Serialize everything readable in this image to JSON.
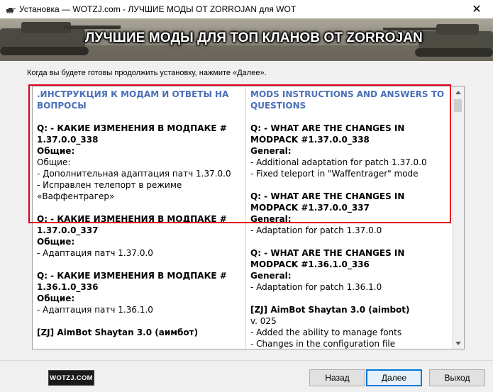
{
  "window": {
    "title": "Установка — WOTZJ.com - ЛУЧШИЕ МОДЫ ОТ ZORROJAN для WOT",
    "close_glyph": "✕"
  },
  "banner": {
    "title": "ЛУЧШИЕ МОДЫ ДЛЯ ТОП КЛАНОВ ОТ ZORROJAN"
  },
  "instruction": "Когда вы будете готовы продолжить установку, нажмите «Далее».",
  "left_column": {
    "heading": ".ИНСТРУКЦИЯ К МОДАМ И ОТВЕТЫ НА ВОПРОСЫ",
    "q1": "Q: - КАКИЕ ИЗМЕНЕНИЯ В МОДПАКЕ # 1.37.0.0_338",
    "q1_sub": "Общие:",
    "q1_lines": [
      "Общие:",
      "- Дополнительная адаптация патч 1.37.0.0",
      "- Исправлен телепорт в режиме «Ваффентрагер»"
    ],
    "q2": "Q: - КАКИЕ ИЗМЕНЕНИЯ В МОДПАКЕ # 1.37.0.0_337",
    "q2_sub": "Общие:",
    "q2_line": "- Адаптация патч 1.37.0.0",
    "q3": "Q: - КАКИЕ ИЗМЕНЕНИЯ В МОДПАКЕ # 1.36.1.0_336",
    "q3_sub": "Общие:",
    "q3_line": "- Адаптация патч 1.36.1.0",
    "q4": "[ZJ] AimBot Shaytan 3.0 (аимбот)"
  },
  "right_column": {
    "heading": "MODS INSTRUCTIONS AND ANSWERS TO QUESTIONS",
    "q1": "Q: - WHAT ARE THE CHANGES IN MODPACK #1.37.0.0_338",
    "q1_sub": "General:",
    "q1_lines": [
      "- Additional adaptation for patch 1.37.0.0",
      "- Fixed teleport in \"Waffentrager\" mode"
    ],
    "q2": "Q: - WHAT ARE THE CHANGES IN MODPACK #1.37.0.0_337",
    "q2_sub": "General:",
    "q2_line": "- Adaptation for patch 1.37.0.0",
    "q3": "Q: - WHAT ARE THE CHANGES IN MODPACK #1.36.1.0_336",
    "q3_sub": "General:",
    "q3_line": "- Adaptation for patch 1.36.1.0",
    "q4": "[ZJ] AimBot Shaytan 3.0 (aimbot)",
    "q4_lines": [
      "v. 025",
      "- Added the ability to manage fonts",
      "- Changes in the configuration file"
    ]
  },
  "footer": {
    "logo": "WOTZJ.COM",
    "back_label": "Назад",
    "next_label": "Далее",
    "exit_label": "Выход"
  },
  "colors": {
    "heading": "#4a6fb8",
    "highlight": "#e0001a",
    "default_button_border": "#0078d7"
  }
}
